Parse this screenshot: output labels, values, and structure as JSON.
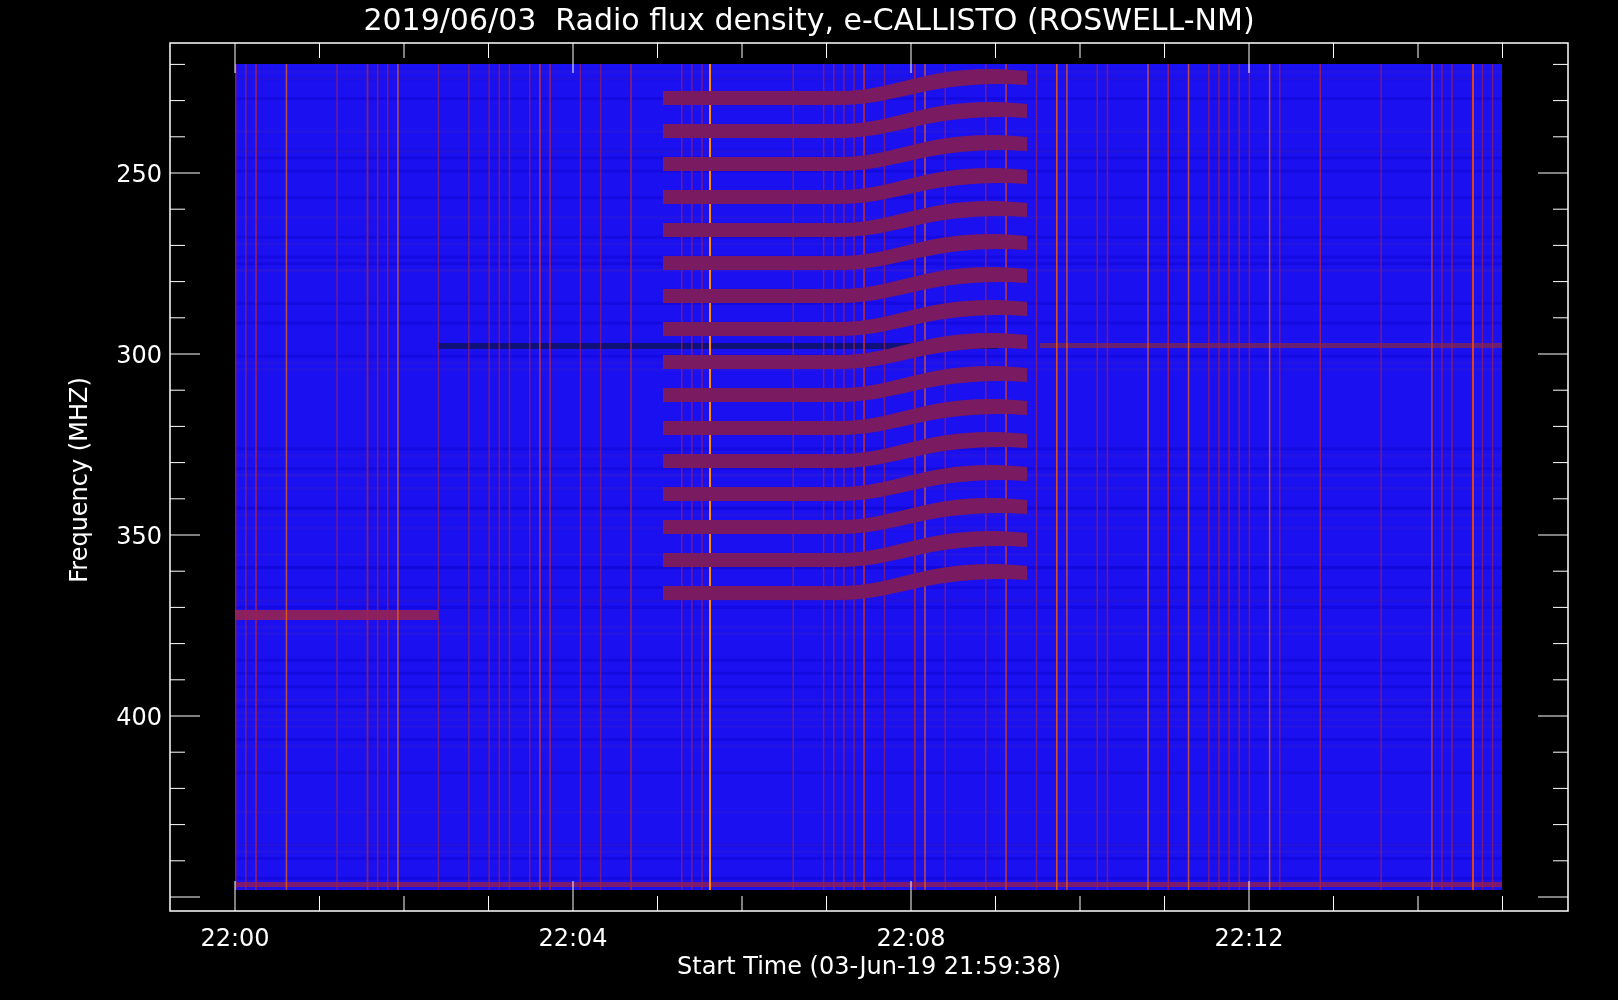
{
  "title": "2019/06/03  Radio flux density, e-CALLISTO (ROSWELL-NM)",
  "y_axis": {
    "label": "Frequency (MHZ)",
    "tick_labels": [
      "250",
      "300",
      "350",
      "400"
    ]
  },
  "x_axis": {
    "label": "Start Time (03-Jun-19 21:59:38)",
    "tick_labels": [
      "22:00",
      "22:04",
      "22:08",
      "22:12"
    ]
  }
}
